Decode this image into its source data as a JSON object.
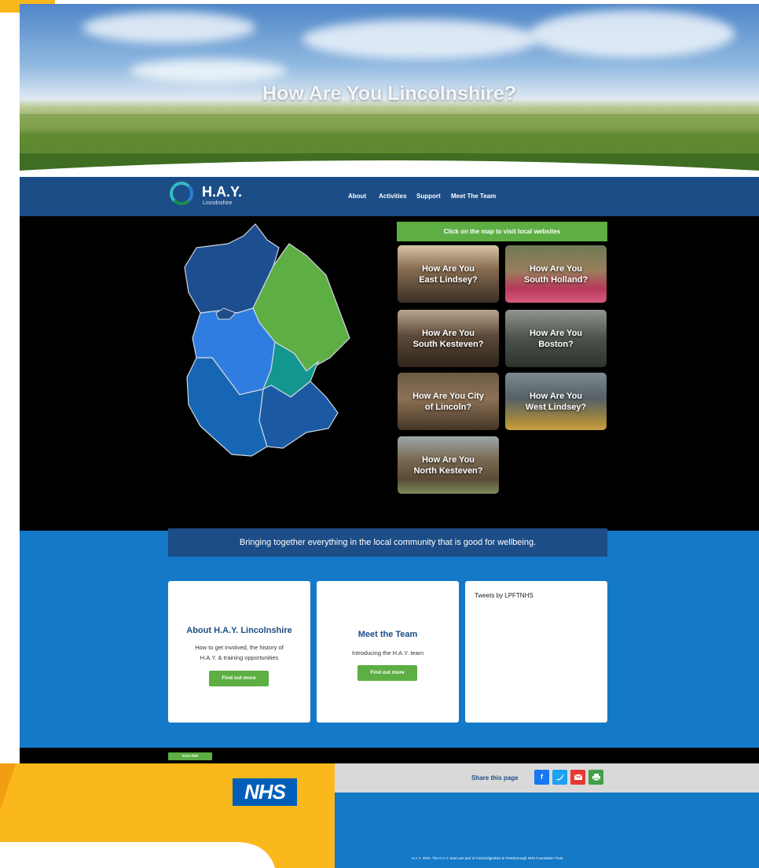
{
  "hero": {
    "title": "How Are You Lincolnshire?"
  },
  "nav": {
    "logo_text": "H.A.Y.",
    "logo_sub": "Lincolnshire",
    "links": [
      "About",
      "Activities",
      "Support",
      "Meet The Team"
    ]
  },
  "map": {
    "button_label": "Click on the map to visit local websites",
    "tiles": [
      {
        "label_1": "How Are You",
        "label_2": "East Lindsey?"
      },
      {
        "label_1": "How Are You",
        "label_2": "South Holland?"
      },
      {
        "label_1": "How Are You",
        "label_2": "South Kesteven?"
      },
      {
        "label_1": "How Are You",
        "label_2": "Boston?"
      },
      {
        "label_1": "How Are You City",
        "label_2": "of Lincoln?"
      },
      {
        "label_1": "How Are You",
        "label_2": "West Lindsey?"
      },
      {
        "label_1": "How Are You",
        "label_2": "North Kesteven?"
      }
    ],
    "region_colors": [
      "#1d4e8f",
      "#5dae43",
      "#2f7de1",
      "#13968f",
      "#1766b3",
      "#1b5aa3",
      "#1e4d86"
    ]
  },
  "tagline": "Bringing together everything in the local community that is good for wellbeing.",
  "cards": {
    "about": {
      "title": "About H.A.Y. Lincolnshire",
      "text_1": "How to get involved, the history of",
      "text_2": "H.A.Y. & training opportunities",
      "button": "Find out more"
    },
    "team": {
      "title": "Meet the Team",
      "text": "Introducing the H.A.Y. team",
      "button": "Find out more"
    },
    "tweets": {
      "title": "Tweets by LPFTNHS"
    }
  },
  "print_button": "Print  PDF",
  "share": {
    "label": "Share this page",
    "icons": [
      "facebook-icon",
      "twitter-icon",
      "email-icon",
      "print-icon"
    ],
    "colors": [
      "#1877f2",
      "#1da1f2",
      "#e53935",
      "#43a047"
    ]
  },
  "nhs_logo": "NHS",
  "footer": {
    "copyright": "H.A.Y. 2022. The H.A.Y. team are part of Cambridgeshire & Peterborough NHS Foundation Trust"
  }
}
